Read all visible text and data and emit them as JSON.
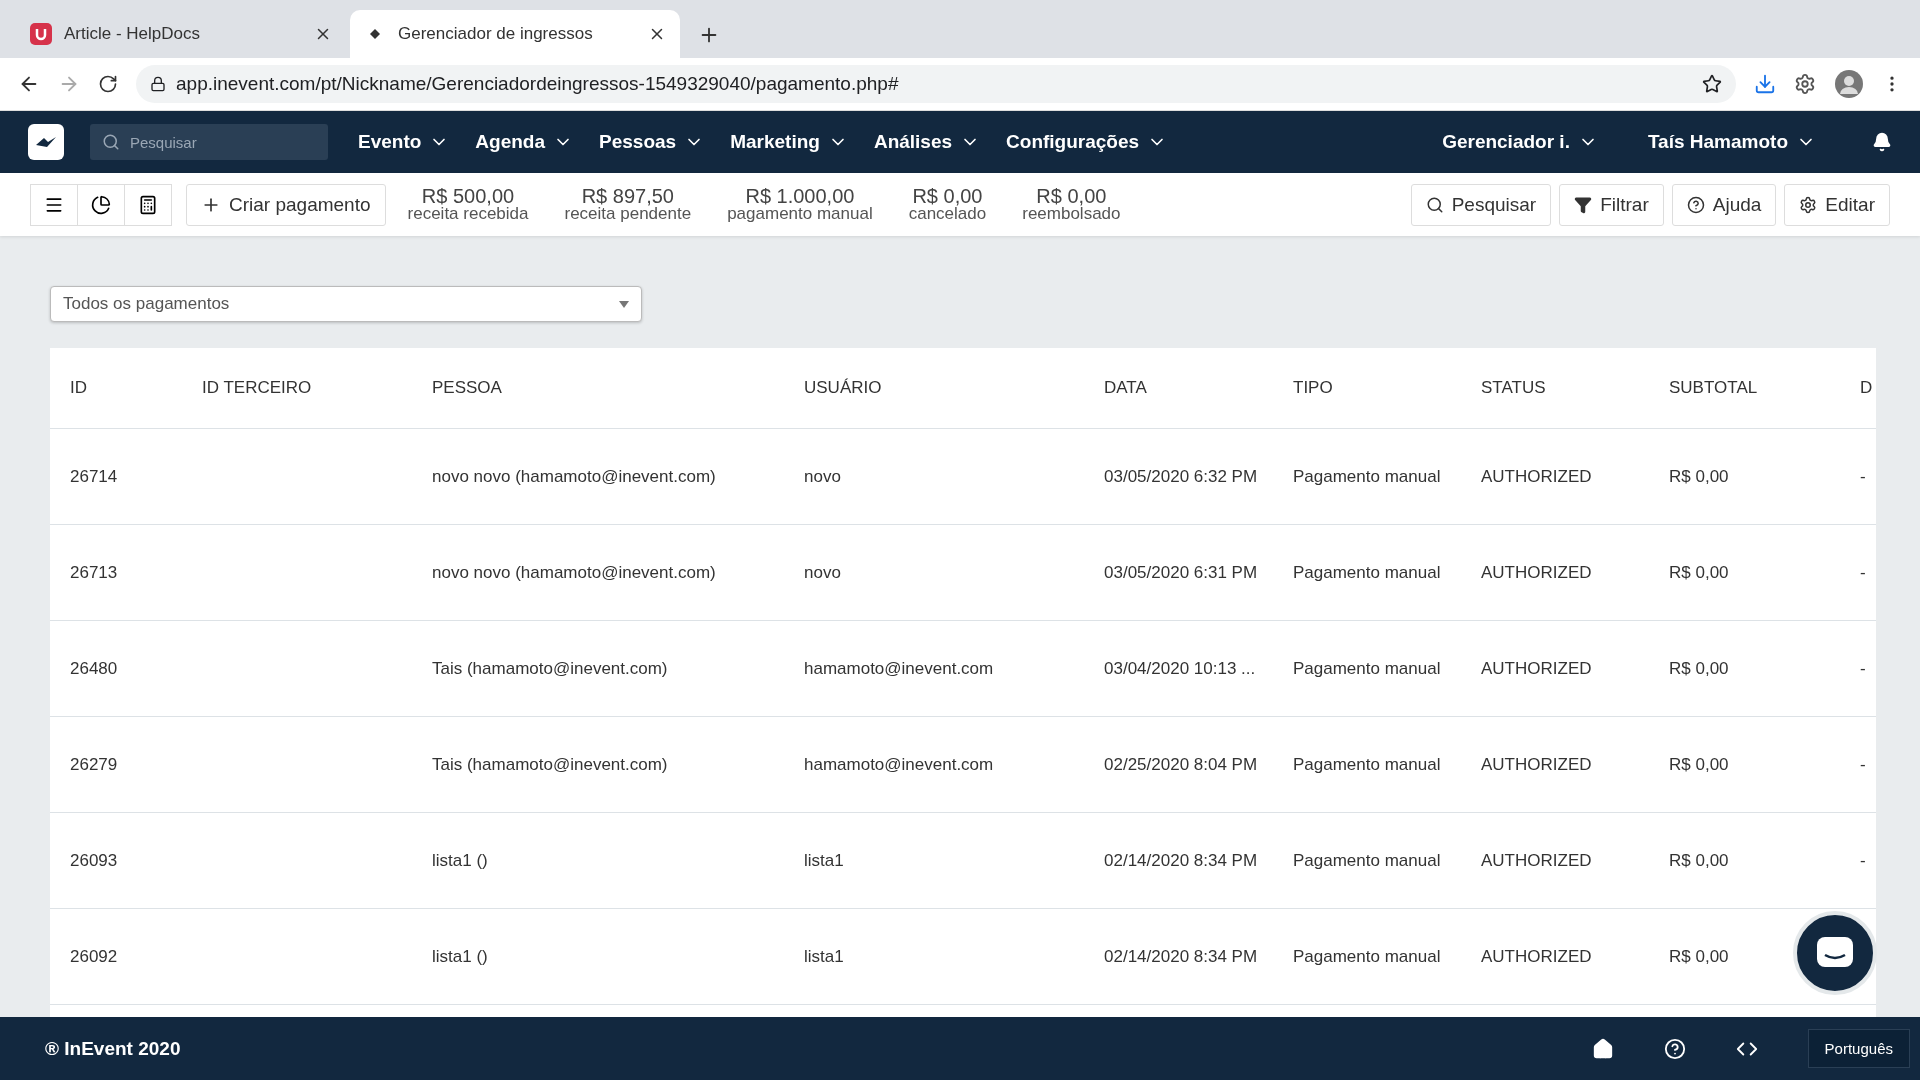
{
  "browser": {
    "tabs": [
      {
        "title": "Article - HelpDocs",
        "selected": false
      },
      {
        "title": "Gerenciador de ingressos",
        "selected": true
      }
    ],
    "url": "app.inevent.com/pt/Nickname/Gerenciadordeingressos-1549329040/pagamento.php#"
  },
  "navbar": {
    "search": {
      "placeholder": "Pesquisar"
    },
    "menus": [
      "Evento",
      "Agenda",
      "Pessoas",
      "Marketing",
      "Análises",
      "Configurações"
    ],
    "right_menus": [
      "Gerenciador i.",
      "Taís Hamamoto"
    ]
  },
  "toolbar": {
    "create_button": "Criar pagamento",
    "stats": [
      {
        "value": "R$ 500,00",
        "label": "receita recebida"
      },
      {
        "value": "R$ 897,50",
        "label": "receita pendente"
      },
      {
        "value": "R$ 1.000,00",
        "label": "pagamento manual"
      },
      {
        "value": "R$ 0,00",
        "label": "cancelado"
      },
      {
        "value": "R$ 0,00",
        "label": "reembolsado"
      }
    ],
    "actions": [
      {
        "kind": "search",
        "label": "Pesquisar"
      },
      {
        "kind": "filter",
        "label": "Filtrar"
      },
      {
        "kind": "help",
        "label": "Ajuda"
      },
      {
        "kind": "edit",
        "label": "Editar"
      }
    ]
  },
  "filter": {
    "value": "Todos os pagamentos"
  },
  "table": {
    "columns": [
      "ID",
      "ID TERCEIRO",
      "PESSOA",
      "USUÁRIO",
      "DATA",
      "TIPO",
      "STATUS",
      "SUBTOTAL",
      "D"
    ],
    "rows": [
      {
        "id": "26714",
        "person": "novo novo (hamamoto@inevent.com)",
        "user": "novo",
        "date": "03/05/2020 6:32 PM",
        "type": "Pagamento manual",
        "status": "AUTHORIZED",
        "subtotal": "R$ 0,00",
        "column_9": "-"
      },
      {
        "id": "26713",
        "person": "novo novo (hamamoto@inevent.com)",
        "user": "novo",
        "date": "03/05/2020 6:31 PM",
        "type": "Pagamento manual",
        "status": "AUTHORIZED",
        "subtotal": "R$ 0,00",
        "column_9": "-"
      },
      {
        "id": "26480",
        "person": "Tais (hamamoto@inevent.com)",
        "user": "hamamoto@inevent.com",
        "date": "03/04/2020 10:13 ...",
        "type": "Pagamento manual",
        "status": "AUTHORIZED",
        "subtotal": "R$ 0,00",
        "column_9": "-"
      },
      {
        "id": "26279",
        "person": "Tais (hamamoto@inevent.com)",
        "user": "hamamoto@inevent.com",
        "date": "02/25/2020 8:04 PM",
        "type": "Pagamento manual",
        "status": "AUTHORIZED",
        "subtotal": "R$ 0,00",
        "column_9": "-"
      },
      {
        "id": "26093",
        "person": "lista1 ()",
        "user": "lista1",
        "date": "02/14/2020 8:34 PM",
        "type": "Pagamento manual",
        "status": "AUTHORIZED",
        "subtotal": "R$ 0,00",
        "column_9": "-"
      },
      {
        "id": "26092",
        "person": "lista1 ()",
        "user": "lista1",
        "date": "02/14/2020 8:34 PM",
        "type": "Pagamento manual",
        "status": "AUTHORIZED",
        "subtotal": "R$ 0,00"
      }
    ]
  },
  "footer": {
    "copyright": "® InEvent 2020",
    "language": "Português"
  }
}
